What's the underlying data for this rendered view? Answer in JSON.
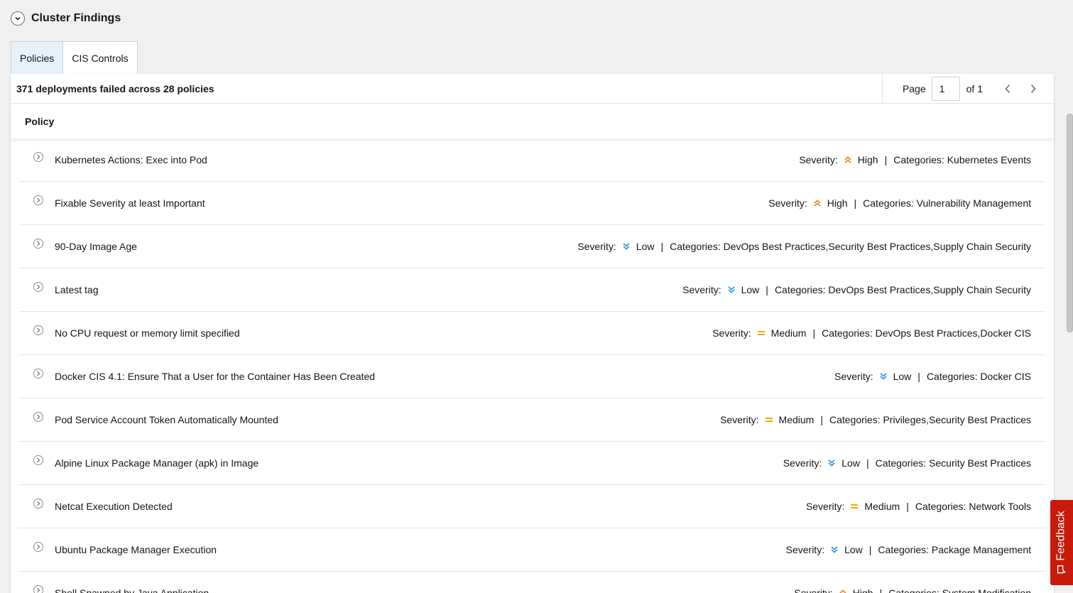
{
  "section": {
    "title": "Cluster Findings",
    "toggle_icon": "chevron-down-icon"
  },
  "tabs": [
    {
      "label": "Policies",
      "active": true
    },
    {
      "label": "CIS Controls",
      "active": false
    }
  ],
  "summary": "371 deployments failed across 28 policies",
  "pagination": {
    "page_label": "Page",
    "page_value": "1",
    "of_label": "of 1"
  },
  "table": {
    "column_header": "Policy"
  },
  "severity_label": "Severity:",
  "categories_label": "Categories:",
  "colors": {
    "high": "#f0822b",
    "medium": "#f0ab00",
    "low": "#2b9af3",
    "feedback": "#c9190b"
  },
  "rows": [
    {
      "name": "Kubernetes Actions: Exec into Pod",
      "severity": "High",
      "level": "high",
      "categories": "Kubernetes Events"
    },
    {
      "name": "Fixable Severity at least Important",
      "severity": "High",
      "level": "high",
      "categories": "Vulnerability Management"
    },
    {
      "name": "90-Day Image Age",
      "severity": "Low",
      "level": "low",
      "categories": "DevOps Best Practices,Security Best Practices,Supply Chain Security"
    },
    {
      "name": "Latest tag",
      "severity": "Low",
      "level": "low",
      "categories": "DevOps Best Practices,Supply Chain Security"
    },
    {
      "name": "No CPU request or memory limit specified",
      "severity": "Medium",
      "level": "medium",
      "categories": "DevOps Best Practices,Docker CIS"
    },
    {
      "name": "Docker CIS 4.1: Ensure That a User for the Container Has Been Created",
      "severity": "Low",
      "level": "low",
      "categories": "Docker CIS"
    },
    {
      "name": "Pod Service Account Token Automatically Mounted",
      "severity": "Medium",
      "level": "medium",
      "categories": "Privileges,Security Best Practices"
    },
    {
      "name": "Alpine Linux Package Manager (apk) in Image",
      "severity": "Low",
      "level": "low",
      "categories": "Security Best Practices"
    },
    {
      "name": "Netcat Execution Detected",
      "severity": "Medium",
      "level": "medium",
      "categories": "Network Tools"
    },
    {
      "name": "Ubuntu Package Manager Execution",
      "severity": "Low",
      "level": "low",
      "categories": "Package Management"
    },
    {
      "name": "Shell Spawned by Java Application",
      "severity": "High",
      "level": "high",
      "categories": "System Modification"
    }
  ],
  "feedback": {
    "label": "Feedback",
    "icon": "chat-bubble-icon"
  }
}
